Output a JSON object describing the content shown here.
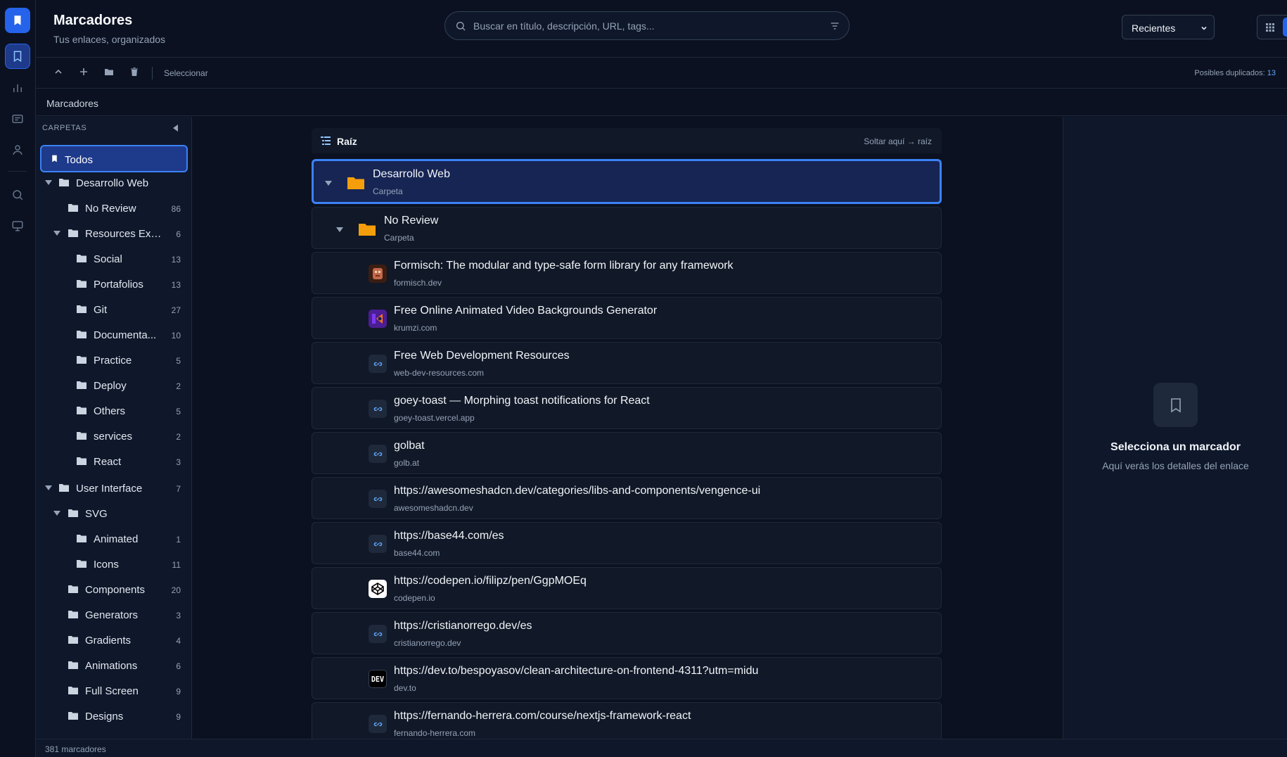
{
  "app": {
    "title": "Marcadores",
    "subtitle": "Tus enlaces, organizados"
  },
  "search": {
    "placeholder": "Buscar en título, descripción, URL, tags...",
    "value": ""
  },
  "sort": {
    "selected": "Recientes"
  },
  "toolbar": {
    "select_label": "Seleccionar",
    "duplicates_label": "Posibles duplicados:",
    "duplicates_count": "13"
  },
  "breadcrumb": {
    "label": "Marcadores"
  },
  "sidebar": {
    "heading": "CARPETAS",
    "todos_label": "Todos",
    "folders": [
      {
        "label": "Desarrollo Web",
        "count": "",
        "expanded": true
      },
      {
        "label": "No Review",
        "count": "86"
      },
      {
        "label": "Resources Extra",
        "count": "6",
        "expanded": true
      },
      {
        "label": "Social",
        "count": "13"
      },
      {
        "label": "Portafolios",
        "count": "13"
      },
      {
        "label": "Git",
        "count": "27"
      },
      {
        "label": "Documenta...",
        "count": "10"
      },
      {
        "label": "Practice",
        "count": "5"
      },
      {
        "label": "Deploy",
        "count": "2"
      },
      {
        "label": "Others",
        "count": "5"
      },
      {
        "label": "services",
        "count": "2"
      },
      {
        "label": "React",
        "count": "3"
      },
      {
        "label": "User Interface",
        "count": "7",
        "expanded": true
      },
      {
        "label": "SVG",
        "count": "",
        "expanded": true
      },
      {
        "label": "Animated",
        "count": "1"
      },
      {
        "label": "Icons",
        "count": "11"
      },
      {
        "label": "Components",
        "count": "20"
      },
      {
        "label": "Generators",
        "count": "3"
      },
      {
        "label": "Gradients",
        "count": "4"
      },
      {
        "label": "Animations",
        "count": "6"
      },
      {
        "label": "Full Screen",
        "count": "9"
      },
      {
        "label": "Designs",
        "count": "9"
      }
    ]
  },
  "main": {
    "root_label": "Raíz",
    "drop_hint": "Soltar aquí → raíz",
    "items": [
      {
        "title": "Desarrollo Web",
        "subtitle": "Carpeta",
        "kind": "folder"
      },
      {
        "title": "No Review",
        "subtitle": "Carpeta",
        "kind": "folder"
      },
      {
        "title": "Formisch: The modular and type-safe form library for any framework",
        "subtitle": "formisch.dev",
        "kind": "link",
        "icon": "formisch-favicon"
      },
      {
        "title": "Free Online Animated Video Backgrounds Generator",
        "subtitle": "krumzi.com",
        "kind": "link",
        "icon": "krumzi-favicon"
      },
      {
        "title": "Free Web Development Resources",
        "subtitle": "web-dev-resources.com",
        "kind": "link",
        "icon": "link-icon"
      },
      {
        "title": "goey-toast — Morphing toast notifications for React",
        "subtitle": "goey-toast.vercel.app",
        "kind": "link",
        "icon": "link-icon"
      },
      {
        "title": "golbat",
        "subtitle": "golb.at",
        "kind": "link",
        "icon": "link-icon"
      },
      {
        "title": "https://awesomeshadcn.dev/categories/libs-and-components/vengence-ui",
        "subtitle": "awesomeshadcn.dev",
        "kind": "link",
        "icon": "link-icon"
      },
      {
        "title": "https://base44.com/es",
        "subtitle": "base44.com",
        "kind": "link",
        "icon": "link-icon"
      },
      {
        "title": "https://codepen.io/filipz/pen/GgpMOEq",
        "subtitle": "codepen.io",
        "kind": "link",
        "icon": "codepen-favicon"
      },
      {
        "title": "https://cristianorrego.dev/es",
        "subtitle": "cristianorrego.dev",
        "kind": "link",
        "icon": "link-icon"
      },
      {
        "title": "https://dev.to/bespoyasov/clean-architecture-on-frontend-4311?utm=midu",
        "subtitle": "dev.to",
        "kind": "link",
        "icon": "devto-favicon"
      },
      {
        "title": "https://fernando-herrera.com/course/nextjs-framework-react",
        "subtitle": "fernando-herrera.com",
        "kind": "link",
        "icon": "link-icon"
      }
    ]
  },
  "detail": {
    "title": "Selecciona un marcador",
    "subtitle": "Aquí verás los detalles del enlace"
  },
  "footer": {
    "count_label": "381 marcadores"
  },
  "colors": {
    "accent": "#2563eb",
    "folder": "#f59e0b",
    "background": "#0b1120"
  }
}
